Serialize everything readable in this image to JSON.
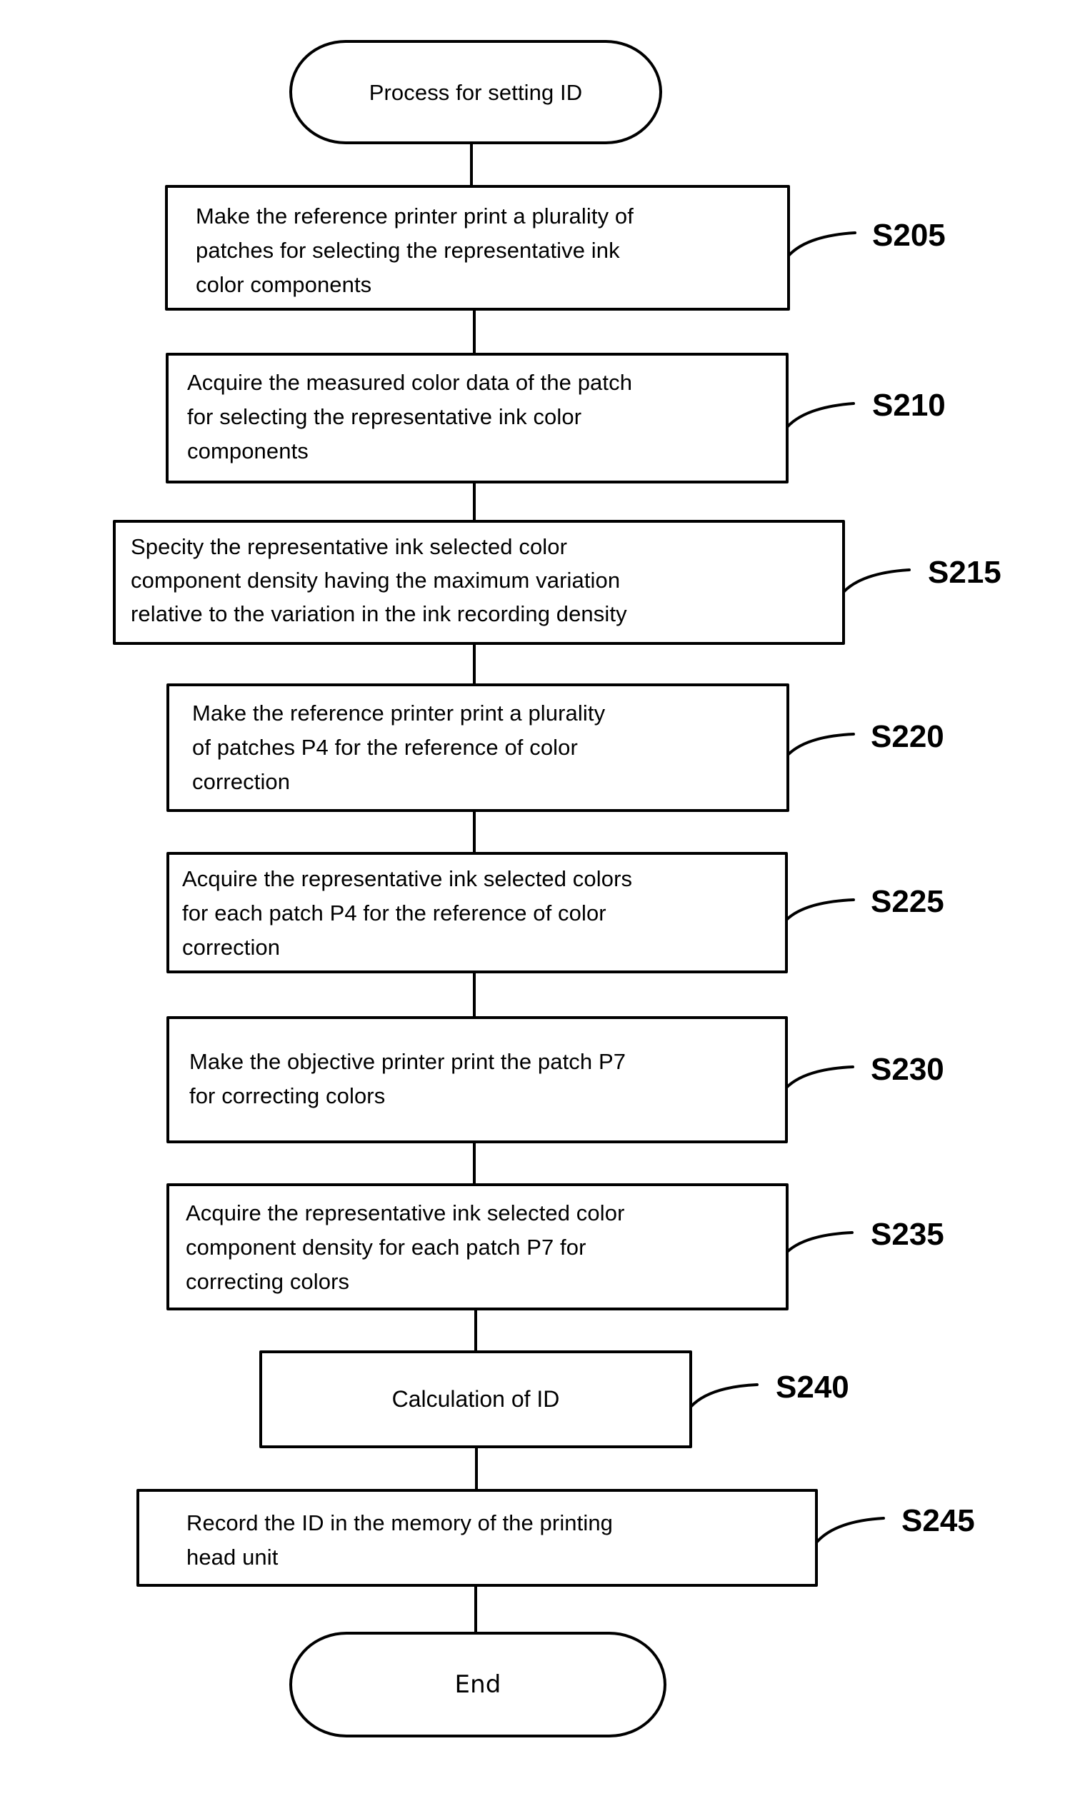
{
  "flowchart": {
    "start": {
      "label": "Process for setting ID"
    },
    "end": {
      "label": "End"
    },
    "steps": [
      {
        "id": "S205",
        "text": "Make the reference printer print a plurality of\npatches for selecting the representative ink\ncolor components"
      },
      {
        "id": "S210",
        "text": "Acquire the measured color data of the patch\nfor selecting the representative ink color\ncomponents"
      },
      {
        "id": "S215",
        "text": "Specity the representative ink selected color\ncomponent density having the maximum variation\nrelative to the variation in the ink recording density"
      },
      {
        "id": "S220",
        "text": "Make the reference printer print a plurality\nof patches P4 for the reference of color\ncorrection"
      },
      {
        "id": "S225",
        "text": "Acquire the representative ink selected colors\nfor each patch P4 for the reference of color\ncorrection"
      },
      {
        "id": "S230",
        "text": "Make the objective printer print the patch P7\nfor correcting colors"
      },
      {
        "id": "S235",
        "text": "Acquire the representative ink selected color\ncomponent density for each patch P7 for\ncorrecting colors"
      },
      {
        "id": "S240",
        "text": "Calculation of ID"
      },
      {
        "id": "S245",
        "text": "Record the ID in the memory of the printing\nhead unit"
      }
    ]
  }
}
